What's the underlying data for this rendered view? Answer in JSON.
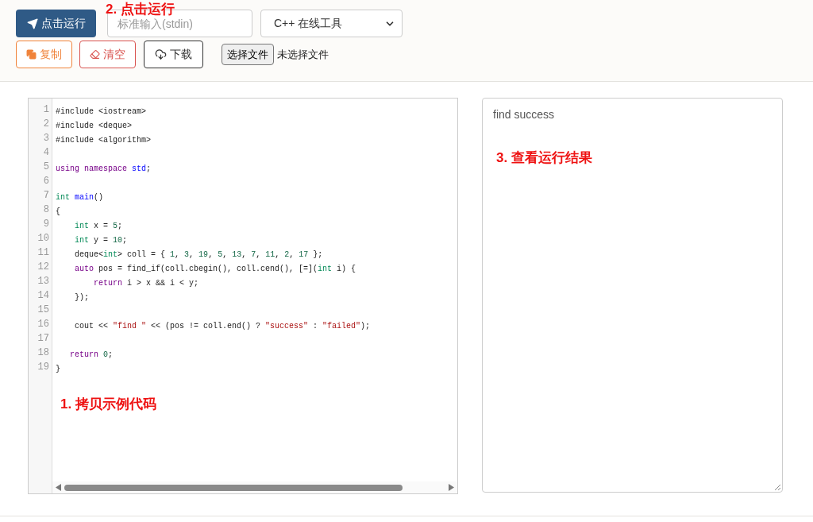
{
  "toolbar": {
    "run_button": "点击运行",
    "stdin": {
      "placeholder": "标准输入(stdin)"
    },
    "language_select": "C++ 在线工具",
    "copy_button": "复制",
    "clear_button": "清空",
    "download_button": "下载",
    "file_button": "选择文件",
    "file_status": "未选择文件"
  },
  "editor": {
    "lines": [
      {
        "number": "1",
        "tokens": [
          {
            "t": "#include <iostream>",
            "kind": "plain"
          }
        ]
      },
      {
        "number": "2",
        "tokens": [
          {
            "t": "#include <deque>",
            "kind": "plain"
          }
        ]
      },
      {
        "number": "3",
        "tokens": [
          {
            "t": "#include <algorithm>",
            "kind": "plain"
          }
        ]
      },
      {
        "number": "4"
      },
      {
        "number": "5",
        "tokens": [
          {
            "t": "using namespace",
            "kind": "keyword"
          },
          {
            "t": " std",
            "kind": "def"
          },
          {
            "t": ";",
            "kind": "plain"
          }
        ]
      },
      {
        "number": "6"
      },
      {
        "number": "7",
        "tokens": [
          {
            "t": "int",
            "kind": "type"
          },
          {
            "t": " main",
            "kind": "def"
          },
          {
            "t": "()",
            "kind": "plain"
          }
        ]
      },
      {
        "number": "8",
        "tokens": [
          {
            "t": "{",
            "kind": "plain"
          }
        ]
      },
      {
        "number": "9",
        "tokens": [
          {
            "t": "    int",
            "kind": "type"
          },
          {
            "t": " x = ",
            "kind": "plain"
          },
          {
            "t": "5",
            "kind": "number"
          },
          {
            "t": ";",
            "kind": "plain"
          }
        ]
      },
      {
        "number": "10",
        "tokens": [
          {
            "t": "    int",
            "kind": "type"
          },
          {
            "t": " y = ",
            "kind": "plain"
          },
          {
            "t": "10",
            "kind": "number"
          },
          {
            "t": ";",
            "kind": "plain"
          }
        ]
      },
      {
        "number": "11",
        "tokens": [
          {
            "t": "    deque<",
            "kind": "plain"
          },
          {
            "t": "int",
            "kind": "type"
          },
          {
            "t": "> coll = { ",
            "kind": "plain"
          },
          {
            "t": "1",
            "kind": "number"
          },
          {
            "t": ", ",
            "kind": "plain"
          },
          {
            "t": "3",
            "kind": "number"
          },
          {
            "t": ", ",
            "kind": "plain"
          },
          {
            "t": "19",
            "kind": "number"
          },
          {
            "t": ", ",
            "kind": "plain"
          },
          {
            "t": "5",
            "kind": "number"
          },
          {
            "t": ", ",
            "kind": "plain"
          },
          {
            "t": "13",
            "kind": "number"
          },
          {
            "t": ", ",
            "kind": "plain"
          },
          {
            "t": "7",
            "kind": "number"
          },
          {
            "t": ", ",
            "kind": "plain"
          },
          {
            "t": "11",
            "kind": "number"
          },
          {
            "t": ", ",
            "kind": "plain"
          },
          {
            "t": "2",
            "kind": "number"
          },
          {
            "t": ", ",
            "kind": "plain"
          },
          {
            "t": "17",
            "kind": "number"
          },
          {
            "t": " };",
            "kind": "plain"
          }
        ]
      },
      {
        "number": "12",
        "tokens": [
          {
            "t": "    auto",
            "kind": "keyword"
          },
          {
            "t": " pos = find_if(coll.cbegin(), coll.cend(), [=](",
            "kind": "plain"
          },
          {
            "t": "int",
            "kind": "type"
          },
          {
            "t": " i) {",
            "kind": "plain"
          }
        ]
      },
      {
        "number": "13",
        "tokens": [
          {
            "t": "        return",
            "kind": "keyword"
          },
          {
            "t": " i > x && i < y;",
            "kind": "plain"
          }
        ]
      },
      {
        "number": "14",
        "tokens": [
          {
            "t": "    });",
            "kind": "plain"
          }
        ]
      },
      {
        "number": "15"
      },
      {
        "number": "16",
        "tokens": [
          {
            "t": "    cout << ",
            "kind": "plain"
          },
          {
            "t": "\"find \"",
            "kind": "string"
          },
          {
            "t": " << (pos != coll.end() ? ",
            "kind": "plain"
          },
          {
            "t": "\"success\"",
            "kind": "string"
          },
          {
            "t": " : ",
            "kind": "plain"
          },
          {
            "t": "\"failed\"",
            "kind": "string"
          },
          {
            "t": ");",
            "kind": "plain"
          }
        ]
      },
      {
        "number": "17"
      },
      {
        "number": "18",
        "tokens": [
          {
            "t": "   return",
            "kind": "keyword"
          },
          {
            "t": " 0",
            "kind": "number"
          },
          {
            "t": ";",
            "kind": "plain"
          }
        ]
      },
      {
        "number": "19",
        "tokens": [
          {
            "t": "}",
            "kind": "plain"
          }
        ]
      }
    ]
  },
  "output": {
    "text": "find success"
  },
  "annotations": [
    {
      "kind": "run",
      "text": "2. 点击运行"
    },
    {
      "kind": "copy",
      "text": "1. 拷贝示例代码"
    },
    {
      "kind": "result",
      "text": "3. 查看运行结果"
    }
  ]
}
